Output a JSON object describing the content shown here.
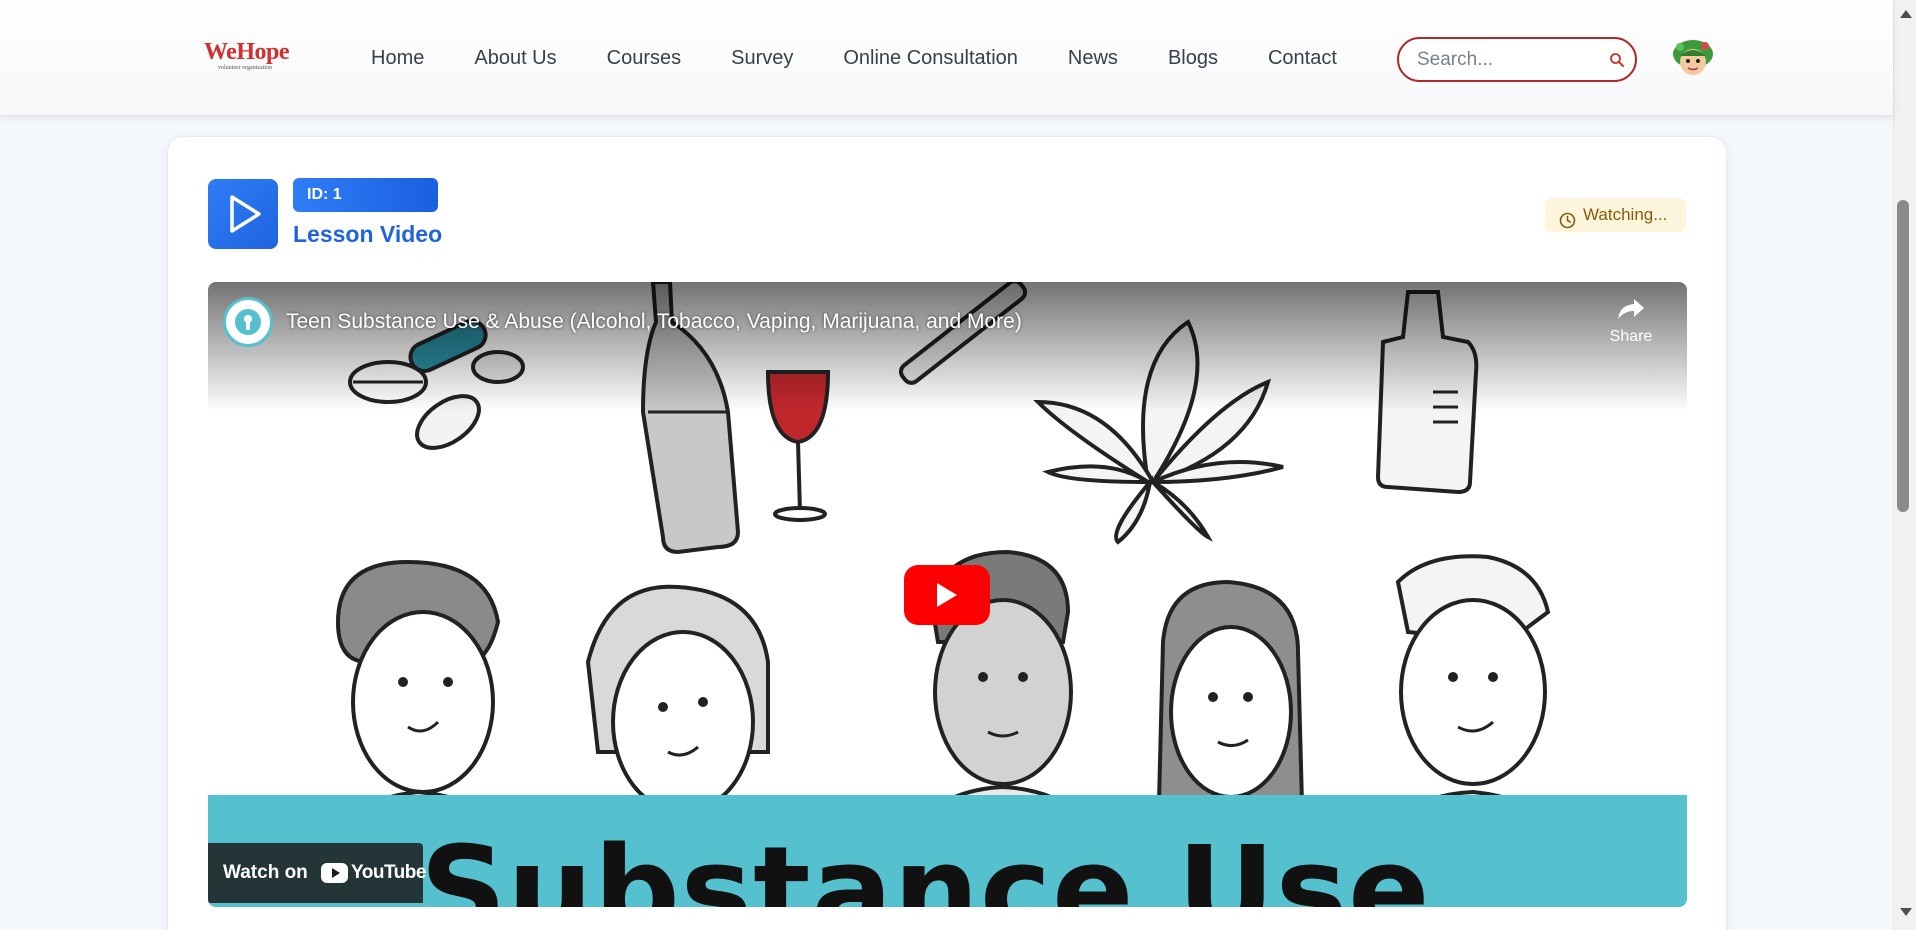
{
  "header": {
    "logo_text": "WeHope",
    "logo_subtitle": "volunteer organization",
    "nav": [
      "Home",
      "About Us",
      "Courses",
      "Survey",
      "Online Consultation",
      "News",
      "Blogs",
      "Contact"
    ],
    "search_placeholder": "Search..."
  },
  "lesson": {
    "id_label": "ID: 1",
    "title": "Lesson Video",
    "status": "Watching...",
    "icons": {
      "tile": "play-icon",
      "status": "clock-icon"
    }
  },
  "video": {
    "title": "Teen Substance Use & Abuse (Alcohol, Tobacco, Vaping, Marijuana, and More)",
    "share_label": "Share",
    "watch_on_label": "Watch on",
    "youtube_label": "YouTube",
    "caption_text": "Substance Use"
  },
  "colors": {
    "brand_red": "#d32f2f",
    "primary_blue": "#1f63e0",
    "status_bg": "#fdf6dc",
    "video_band": "#55c1cf"
  }
}
